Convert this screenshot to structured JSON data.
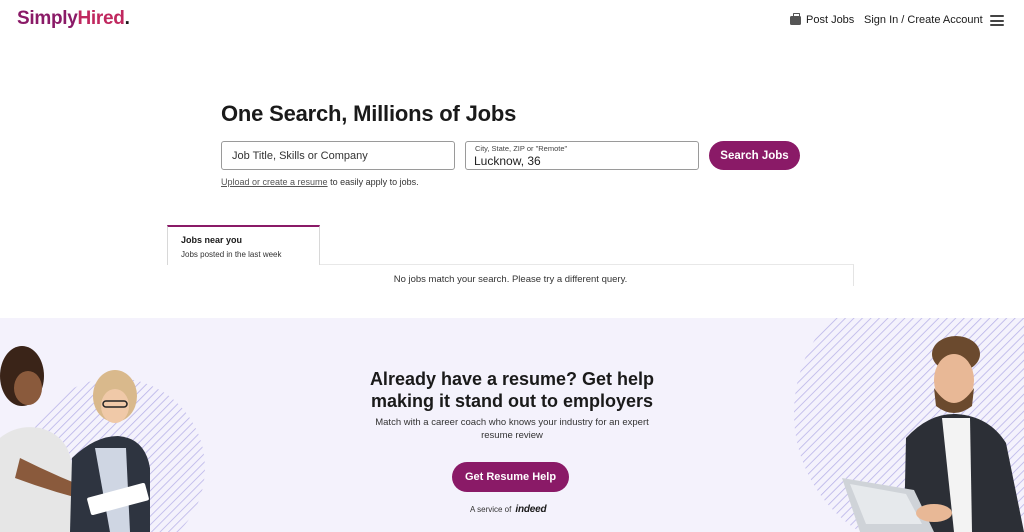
{
  "header": {
    "logo": {
      "part1": "Simply",
      "part2": "Hired",
      "part3": "."
    },
    "post_jobs": "Post Jobs",
    "sign_in": "Sign In / Create Account"
  },
  "search": {
    "title": "One Search, Millions of Jobs",
    "what_placeholder": "Job Title, Skills or Company",
    "where_label": "City, State, ZIP or \"Remote\"",
    "where_value": "Lucknow, 36",
    "button": "Search Jobs",
    "upload_link": "Upload or create a resume",
    "upload_suffix": " to easily apply to jobs."
  },
  "jobs_panel": {
    "tab_title": "Jobs near you",
    "tab_sub": "Jobs posted in the last week",
    "empty_message": "No jobs match your search. Please try a different query."
  },
  "promo": {
    "title_line1": "Already have a resume? Get help",
    "title_line2": "making it stand out to employers",
    "sub_line1": "Match with a career coach who knows your industry for an expert",
    "sub_line2": "resume review",
    "button": "Get Resume Help",
    "service_prefix": "A service of",
    "service_brand": "indeed"
  },
  "colors": {
    "brand": "#8a1a67",
    "promo_bg": "#f4f2fc",
    "stripes": "#b9b3e8"
  }
}
